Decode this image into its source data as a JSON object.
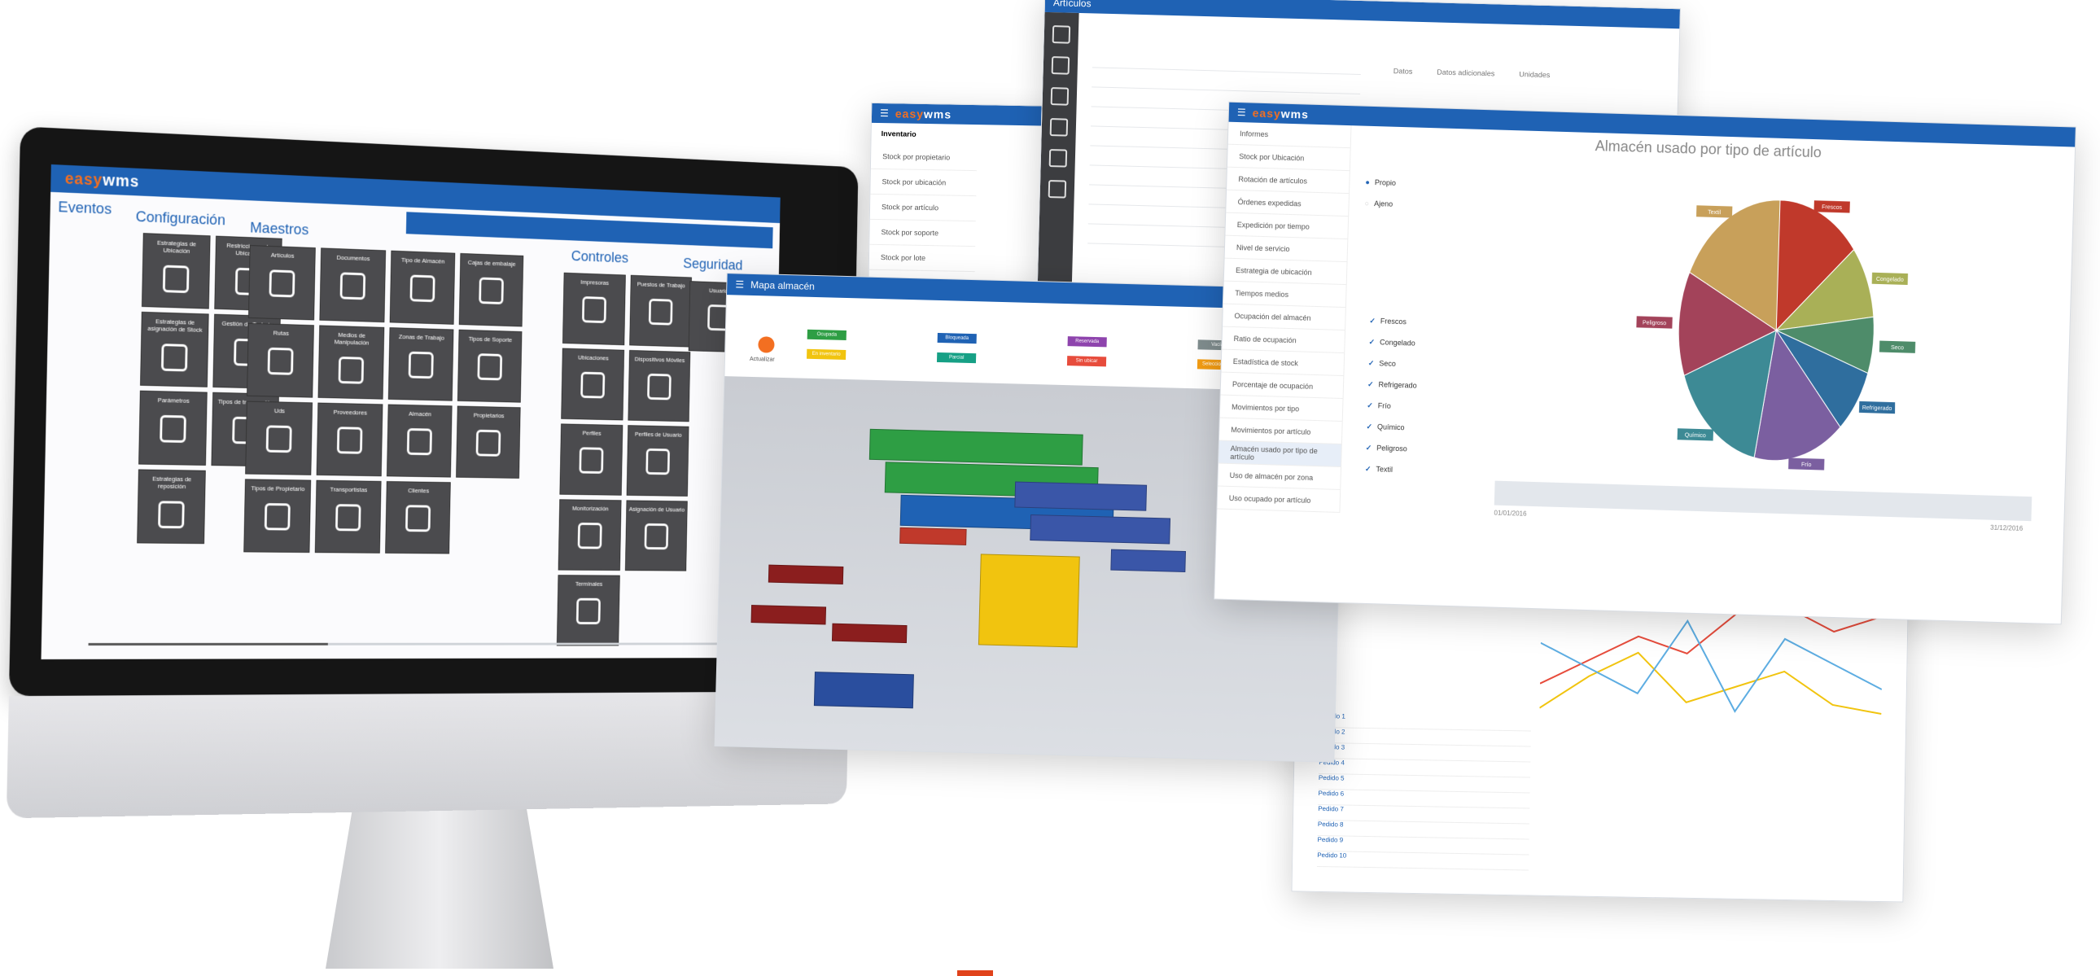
{
  "imac": {
    "logo_a": "easy",
    "logo_b": "wms",
    "sections": {
      "eventos": "Eventos",
      "configuracion": "Configuración",
      "maestros": "Maestros",
      "controles": "Controles",
      "seguridad": "Seguridad"
    },
    "tiles": {
      "configuracion": [
        "Estrategias de Ubicación",
        "Restricciones de Ubicación",
        "Estrategias de asignación de Stock",
        "Gestión de Trabajo",
        "Parámetros",
        "Tipos de transacción",
        "Estrategias de reposición"
      ],
      "maestros": [
        "Artículos",
        "Documentos",
        "Tipo de Almacén",
        "Cajas de embalaje",
        "Rutas",
        "Medios de Manipulación",
        "Zonas de Trabajo",
        "Tipos de Soporte",
        "Uds",
        "Proveedores",
        "Almacén",
        "Propietarios",
        "Tipos de Propietario",
        "Transportistas",
        "Clientes"
      ],
      "controles": [
        "Impresoras",
        "Puestos de Trabajo",
        "Ubicaciones",
        "Dispositivos Móviles",
        "Perfiles",
        "Perfiles de Usuario",
        "Monitorización",
        "Asignación de Usuario",
        "Terminales"
      ],
      "seguridad": [
        "Usuarios"
      ]
    },
    "slider_value": 0.35
  },
  "left_window": {
    "title": "Inventario",
    "items": [
      "Stock por propietario",
      "Stock por ubicación",
      "Stock por artículo",
      "Stock por soporte",
      "Stock por lote"
    ],
    "options": [
      "Propio",
      "Ajeno"
    ]
  },
  "map_window": {
    "title": "Mapa almacén",
    "button": "Actualizar",
    "legend": [
      "Ocupada",
      "Bloqueada",
      "Reservada",
      "Vacía",
      "En inventario",
      "Parcial",
      "Sin ubicar",
      "Seleccionada"
    ]
  },
  "back_window": {
    "title": "Artículos",
    "tabs": [
      "Datos",
      "Datos adicionales",
      "Unidades"
    ]
  },
  "stats_window": {
    "menu": [
      "Informes",
      "Stock por Ubicación",
      "Rotación de artículos",
      "Órdenes expedidas",
      "Expedición por tiempo",
      "Nivel de servicio",
      "Estrategia de ubicación",
      "Tiempos medios",
      "Ocupación del almacén",
      "Ratio de ocupación",
      "Estadística de stock",
      "Porcentaje de ocupación",
      "Movimientos por tipo",
      "Movimientos por artículo",
      "Almacén usado por tipo de artículo",
      "Uso de almacén por zona",
      "Uso ocupado por artículo"
    ],
    "chart_title": "Almacén usado por tipo de artículo",
    "filters": [
      "Propio",
      "Ajeno"
    ],
    "types": [
      "Frescos",
      "Congelado",
      "Seco",
      "Refrigerado",
      "Frío",
      "Químico",
      "Peligroso",
      "Textil"
    ],
    "date_range": [
      "01/01/2016",
      "31/12/2016"
    ]
  },
  "chart_data": {
    "type": "pie",
    "title": "Almacén usado por tipo de artículo",
    "categories": [
      "Frescos",
      "Congelado",
      "Seco",
      "Refrigerado",
      "Frío",
      "Químico",
      "Peligroso",
      "Textil"
    ],
    "values": [
      14,
      9,
      7,
      8,
      15,
      16,
      13,
      18
    ],
    "colors": [
      "#c0392b",
      "#a9b057",
      "#4e8c6a",
      "#2f6e9e",
      "#7b5fa0",
      "#3d8a95",
      "#a3435a",
      "#c8a05a"
    ]
  },
  "bottom_window": {
    "rows": [
      "Pedido 1",
      "Pedido 2",
      "Pedido 3",
      "Pedido 4",
      "Pedido 5",
      "Pedido 6",
      "Pedido 7",
      "Pedido 8",
      "Pedido 9",
      "Pedido 10"
    ]
  },
  "colors": {
    "brand_blue": "#1f62b4",
    "brand_orange": "#f36f21",
    "tile": "#4b4b4e"
  }
}
